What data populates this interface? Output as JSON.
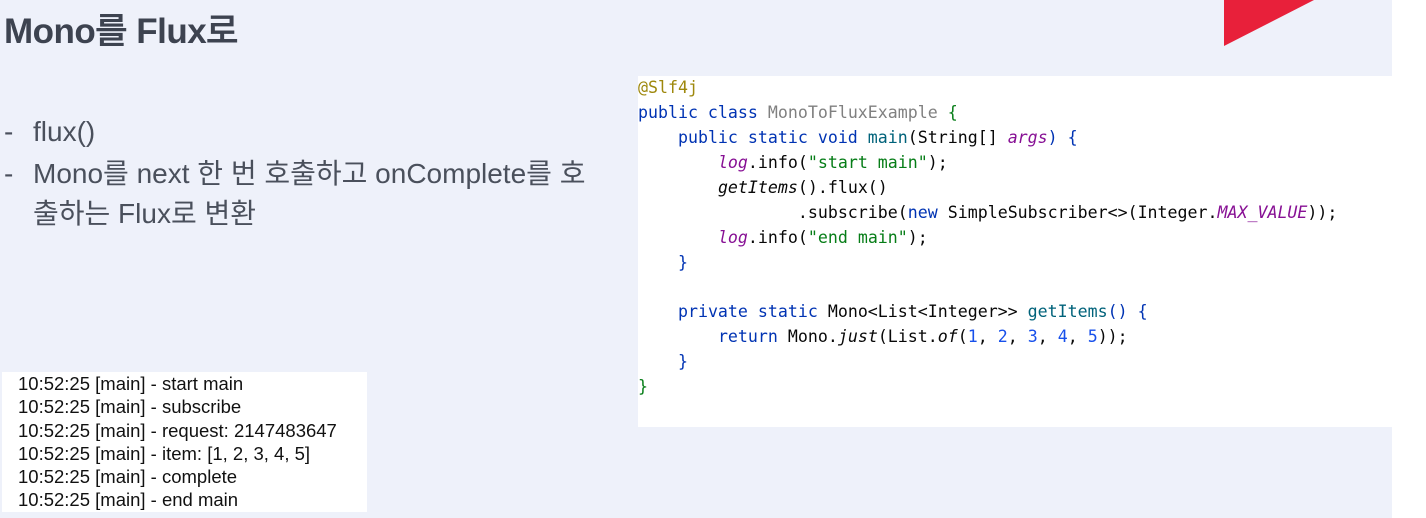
{
  "title": "Mono를 Flux로",
  "bullets": [
    {
      "dash": "-",
      "text": "flux()"
    },
    {
      "dash": "-",
      "text": "Mono를 next 한 번 호출하고 onComplete를 호출하는 Flux로 변환"
    }
  ],
  "console": [
    "10:52:25 [main] - start main",
    "10:52:25 [main] - subscribe",
    "10:52:25 [main] - request: 2147483647",
    "10:52:25 [main] - item: [1, 2, 3, 4, 5]",
    "10:52:25 [main] - complete",
    "10:52:25 [main] - end main"
  ],
  "code": {
    "annotation": "@Slf4j",
    "class_decl": {
      "kw": "public class",
      "name": "MonoToFluxExample",
      "brace": "{"
    },
    "main_decl": {
      "kw": "public static void",
      "fn": "main",
      "open": "(String[]",
      "param": "args",
      "close": ") {"
    },
    "log1": {
      "obj": "log",
      "call": ".info(",
      "str": "\"start main\"",
      "end": ");"
    },
    "get_items_call": {
      "fn": "getItems",
      "rest": "().flux()"
    },
    "subscribe": {
      "pre": ".subscribe(",
      "kw": "new",
      "cls": "SimpleSubscriber<>(Integer.",
      "const": "MAX_VALUE",
      "end": "));"
    },
    "log2": {
      "obj": "log",
      "call": ".info(",
      "str": "\"end main\"",
      "end": ");"
    },
    "close1": "}",
    "items_decl": {
      "kw": "private static",
      "type": "Mono<List<Integer>>",
      "fn": "getItems",
      "end": "() {"
    },
    "return_stmt": {
      "kw": "return",
      "obj": "Mono.",
      "fn": "just",
      "mid": "(List.",
      "fn2": "of",
      "open": "(",
      "nums": [
        "1",
        "2",
        "3",
        "4",
        "5"
      ],
      "end": "));"
    },
    "close2": "}",
    "close3": "}"
  }
}
